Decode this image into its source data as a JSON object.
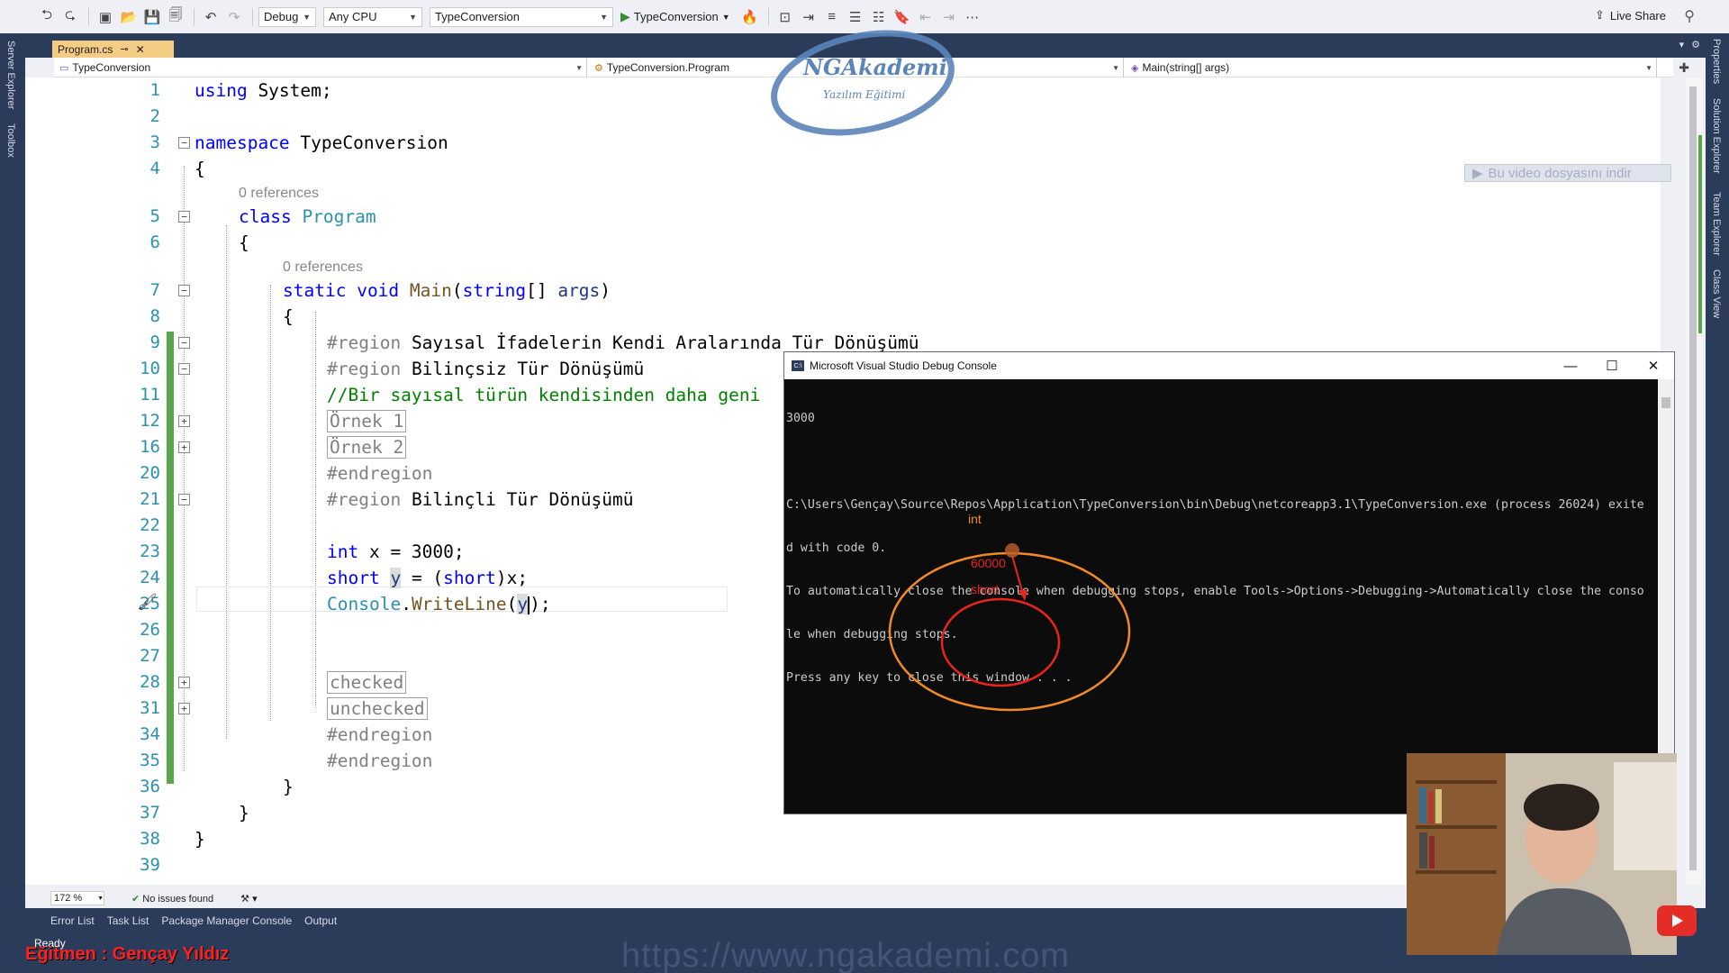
{
  "toolbar": {
    "config": "Debug",
    "platform": "Any CPU",
    "startup_project": "TypeConversion",
    "run_label": "TypeConversion",
    "live_share": "Live Share"
  },
  "side_tabs": {
    "left": [
      "Server Explorer",
      "Toolbox"
    ],
    "right": [
      "Properties",
      "Solution Explorer",
      "Team Explorer",
      "Class View"
    ]
  },
  "tab": {
    "label": "Program.cs"
  },
  "navbar": {
    "project": "TypeConversion",
    "class": "TypeConversion.Program",
    "member": "Main(string[] args)"
  },
  "logo": {
    "name": "NGAkademi",
    "tagline": "Yazılım Eğitimi"
  },
  "download": {
    "label": "Bu video dosyasını indir"
  },
  "editor": {
    "codelens": "0 references",
    "line_numbers": [
      "1",
      "2",
      "3",
      "4",
      "5",
      "6",
      "7",
      "8",
      "9",
      "10",
      "11",
      "12",
      "16",
      "20",
      "21",
      "22",
      "23",
      "24",
      "25",
      "26",
      "27",
      "28",
      "31",
      "34",
      "35",
      "36",
      "37",
      "38",
      "39"
    ],
    "code": {
      "l1_kw": "using",
      "l1_rest": " System;",
      "l3_kw": "namespace",
      "l3_rest": " TypeConversion",
      "open_brace": "{",
      "close_brace": "}",
      "l5_kw": "class",
      "l5_name": "Program",
      "l7_static": "static",
      "l7_void": "void",
      "l7_main": "Main",
      "l7_string": "string",
      "l7_args": "args",
      "l7_bracket": "[] ",
      "l7_open": "(",
      "l7_close": ")",
      "region": "#region",
      "l9_text": "Sayısal İfadelerin Kendi Aralarında Tür Dönüşümü",
      "l10_text": "Bilinçsiz Tür Dönüşümü",
      "l11_comment": "//Bir sayısal türün kendisinden daha geni",
      "ornek1": "Örnek 1",
      "ornek2": "Örnek 2",
      "endregion": "#endregion",
      "l21_text": "Bilinçli Tür Dönüşümü",
      "l23_int": "int",
      "l23_rest": " x = 3000;",
      "l24_short": "short",
      "l24_y": "y",
      "l24_eq": " = (",
      "l24_short2": "short",
      "l24_rest": ")x;",
      "l25_console": "Console",
      "l25_dot": ".",
      "l25_write": "WriteLine",
      "l25_open": "(",
      "l25_y": "y",
      "l25_close": ");",
      "checked": "checked",
      "unchecked": "unchecked"
    }
  },
  "status": {
    "zoom": "172 %",
    "issues": "No issues found",
    "ready": "Ready",
    "watermark_url": "https://www.ngakademi.com",
    "instructor": "Eğitmen : Gençay Yıldız"
  },
  "bottom_tabs": [
    "Error List",
    "Task List",
    "Package Manager Console",
    "Output"
  ],
  "console": {
    "title": "Microsoft Visual Studio Debug Console",
    "lines": [
      "3000",
      "",
      "C:\\Users\\Gençay\\Source\\Repos\\Application\\TypeConversion\\bin\\Debug\\netcoreapp3.1\\TypeConversion.exe (process 26024) exite",
      "d with code 0.",
      "To automatically close the console when debugging stops, enable Tools->Options->Debugging->Automatically close the conso",
      "le when debugging stops.",
      "Press any key to close this window . . ."
    ],
    "annotations": {
      "outer": "int",
      "value": "60000",
      "inner": "short"
    }
  }
}
